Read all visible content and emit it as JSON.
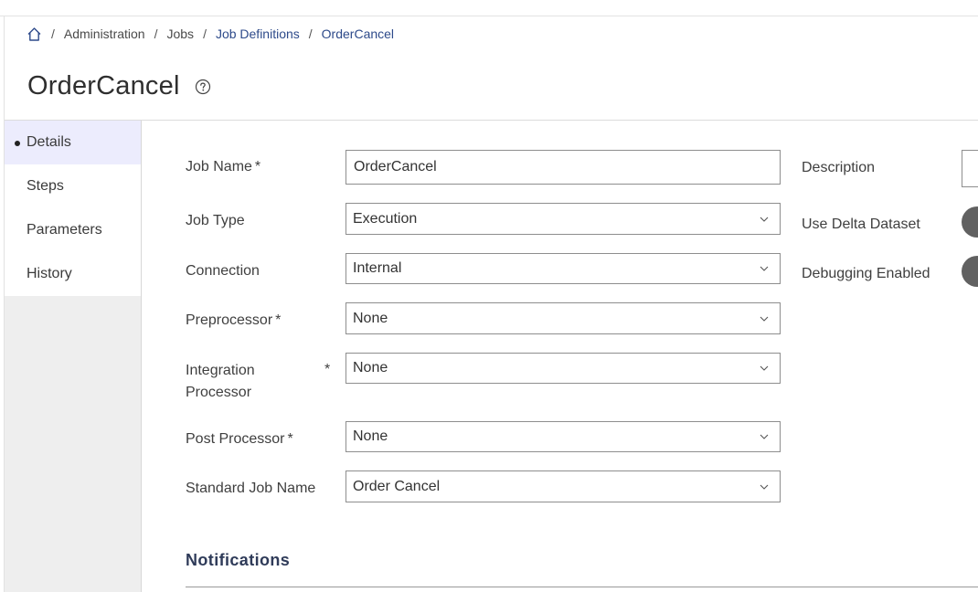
{
  "breadcrumb": {
    "items": [
      {
        "label": "Administration"
      },
      {
        "label": "Jobs"
      },
      {
        "label": "Job Definitions"
      },
      {
        "label": "OrderCancel"
      }
    ],
    "separator": "/"
  },
  "page": {
    "title": "OrderCancel"
  },
  "sidebar": {
    "items": [
      {
        "label": "Details",
        "active": true
      },
      {
        "label": "Steps"
      },
      {
        "label": "Parameters"
      },
      {
        "label": "History"
      }
    ]
  },
  "form": {
    "job_name": {
      "label": "Job Name",
      "value": "OrderCancel",
      "required": "*"
    },
    "job_type": {
      "label": "Job Type",
      "value": "Execution"
    },
    "connection": {
      "label": "Connection",
      "value": "Internal"
    },
    "preprocessor": {
      "label": "Preprocessor",
      "value": "None",
      "required": "*"
    },
    "integration_processor": {
      "label_line1": "Integration",
      "label_line2": "Processor",
      "value": "None",
      "required": "*"
    },
    "post_processor": {
      "label": "Post Processor",
      "value": "None",
      "required": "*"
    },
    "standard_job_name": {
      "label": "Standard Job Name",
      "value": "Order Cancel"
    }
  },
  "right_fields": {
    "description": {
      "label": "Description"
    },
    "use_delta_dataset": {
      "label": "Use Delta Dataset"
    },
    "debugging_enabled": {
      "label": "Debugging Enabled"
    }
  },
  "notifications": {
    "title": "Notifications"
  },
  "colors": {
    "link": "#2d4a8a",
    "active_tab_bg": "#ececfd",
    "toggle": "#616161"
  }
}
